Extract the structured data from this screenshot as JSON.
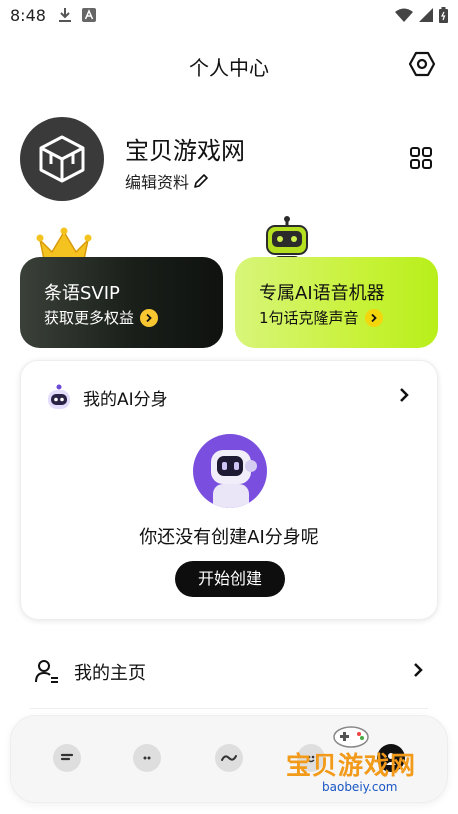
{
  "status_bar": {
    "time": "8:48",
    "left_icons": [
      "download-icon",
      "a-box-icon"
    ],
    "right_icons": [
      "wifi-icon",
      "signal-icon",
      "battery-icon"
    ]
  },
  "header": {
    "title": "个人中心",
    "settings_icon": "hexagon-settings-icon"
  },
  "profile": {
    "username": "宝贝游戏网",
    "edit_label": "编辑资料",
    "avatar_icon": "box-3d-icon",
    "qr_icon": "qr-code-icon"
  },
  "promos": {
    "svip": {
      "title": "条语SVIP",
      "subtitle": "获取更多权益"
    },
    "ai_voice": {
      "title": "专属AI语音机器",
      "subtitle": "1句话克隆声音"
    }
  },
  "ai_card": {
    "title": "我的AI分身",
    "empty_text": "你还没有创建AI分身呢",
    "start_button": "开始创建"
  },
  "menu": {
    "items": [
      {
        "label": "我的主页",
        "icon": "user-list-icon"
      }
    ]
  },
  "bottom_nav": {
    "items": [
      "chat-icon",
      "robot-icon",
      "wave-icon",
      "emoji-icon"
    ]
  },
  "watermark": {
    "text": "宝贝游戏网",
    "url": "baobeiy.com"
  },
  "colors": {
    "svip_bg": "#1a1f1a",
    "ai_voice_bg": "#c9f23a",
    "arrow_yellow": "#f7c631",
    "ai_avatar_bg": "#7a4fe0",
    "button_black": "#0e0e0e"
  }
}
